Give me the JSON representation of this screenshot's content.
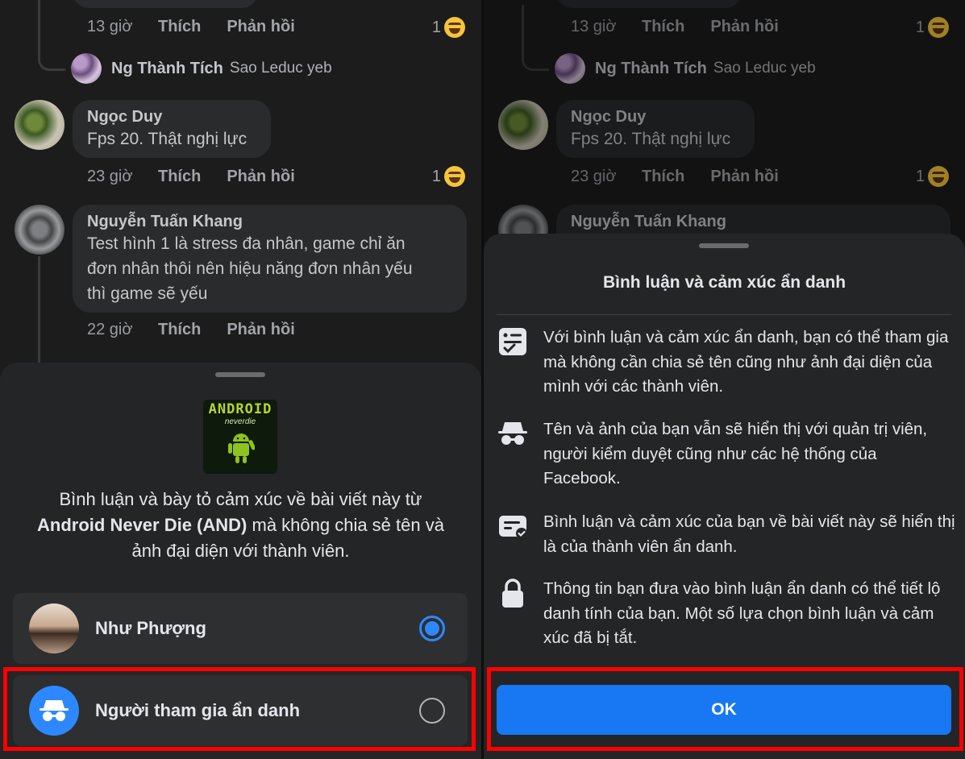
{
  "comments": {
    "top_meta": {
      "time": "13 giờ",
      "like": "Thích",
      "reply": "Phản hồi",
      "reactions": "1"
    },
    "reply_preview": {
      "name": "Ng Thành Tích",
      "text": "Sao Leduc yeb"
    },
    "c1": {
      "name": "Ngọc Duy",
      "text": "Fps 20. Thật nghị lực",
      "time": "23 giờ",
      "like": "Thích",
      "reply": "Phản hồi",
      "reactions": "1"
    },
    "c2": {
      "name": "Nguyễn Tuấn Khang",
      "text_lines": [
        "Test hình 1 là stress đa nhân, game chỉ ăn",
        "đơn nhân thôi nên hiệu năng đơn nhân yếu",
        "thì game sẽ yếu"
      ],
      "time": "22 giờ",
      "like": "Thích",
      "reply": "Phản hồi"
    }
  },
  "left_sheet": {
    "logo_title": "ANDROID",
    "logo_sub": "neverdie",
    "desc_pre": "Bình luận và bày tỏ cảm xúc về bài viết này từ",
    "desc_bold": "Android Never Die (AND)",
    "desc_post": " mà không chia sẻ tên và ảnh đại diện với thành viên.",
    "options": [
      {
        "label": "Như Phượng",
        "selected": true
      },
      {
        "label": "Người tham gia ẩn danh",
        "selected": false
      }
    ]
  },
  "right_sheet": {
    "title": "Bình luận và cảm xúc ẩn danh",
    "items": [
      {
        "icon": "checklist-icon",
        "text": "Với bình luận và cảm xúc ẩn danh, bạn có thể tham gia mà không cần chia sẻ tên cũng như ảnh đại diện của mình với các thành viên."
      },
      {
        "icon": "incognito-icon",
        "text": "Tên và ảnh của bạn vẫn sẽ hiển thị với quản trị viên, người kiểm duyệt cũng như các hệ thống của Facebook."
      },
      {
        "icon": "comment-check-icon",
        "text": "Bình luận và cảm xúc của bạn về bài viết này sẽ hiển thị là của thành viên ẩn danh."
      },
      {
        "icon": "lock-icon",
        "text": "Thông tin bạn đưa vào bình luận ẩn danh có thể tiết lộ danh tính của bạn. Một số lựa chọn bình luận và cảm xúc đã bị tắt."
      }
    ],
    "ok_label": "OK"
  },
  "colors": {
    "accent": "#1877f2",
    "radio": "#2d88ff",
    "highlight": "#ff0000",
    "sheet_bg": "#242526"
  }
}
